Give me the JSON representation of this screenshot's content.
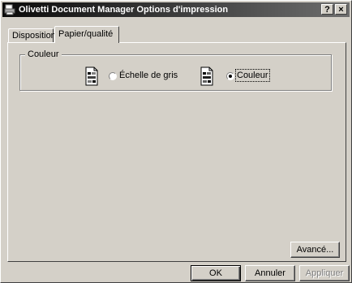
{
  "window": {
    "title": "Olivetti Document Manager Options d'impression"
  },
  "titlebar": {
    "help_label": "?",
    "close_label": "×"
  },
  "tabs": [
    {
      "label": "Disposition",
      "active": false
    },
    {
      "label": "Papier/qualité",
      "active": true
    }
  ],
  "color_group": {
    "label": "Couleur",
    "options": [
      {
        "label": "Échelle de gris",
        "selected": false,
        "icon": "grayscale-document-icon"
      },
      {
        "label": "Couleur",
        "selected": true,
        "icon": "color-document-icon"
      }
    ]
  },
  "buttons": {
    "advanced": "Avancé...",
    "ok": "OK",
    "cancel": "Annuler",
    "apply": "Appliquer"
  }
}
